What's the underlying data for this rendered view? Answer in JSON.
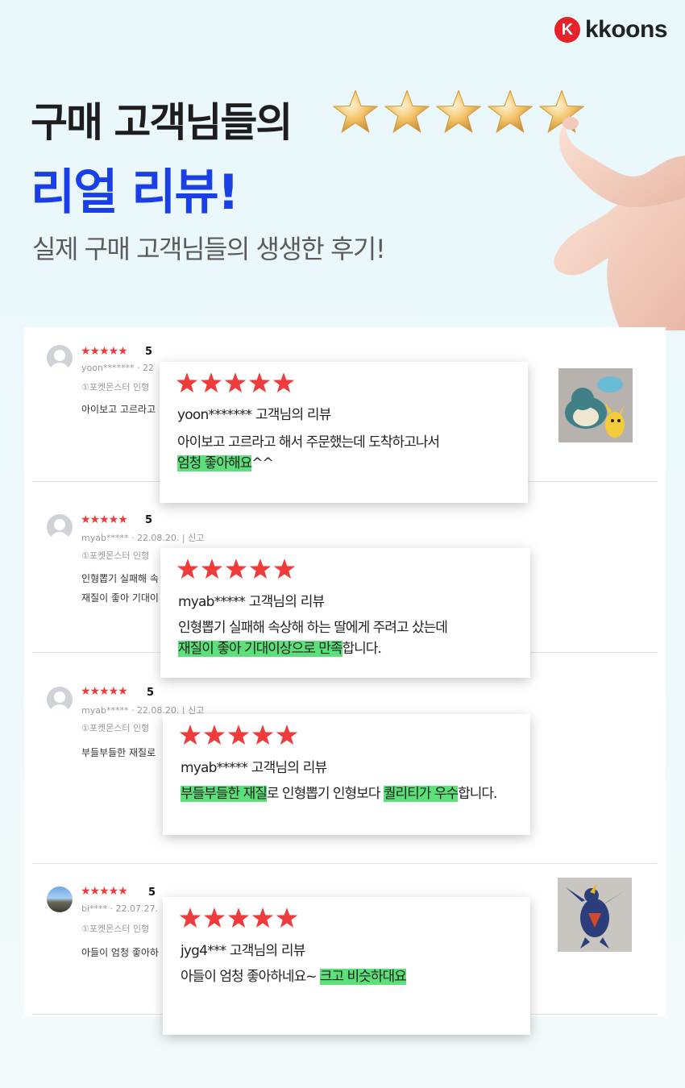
{
  "brand": {
    "mark": "K",
    "name": "kkoons"
  },
  "hero": {
    "line1": "구매 고객님들의",
    "line2": "리얼 리뷰!",
    "subtitle": "실제 구매 고객님들의 생생한 후기!",
    "star_count": 5
  },
  "reviews": [
    {
      "stars": "★★★★★",
      "score": "5",
      "user": "yoon*******",
      "meta": "yoon*******  · 22",
      "option": "①포켓몬스터 인형",
      "body": "아이보고 고르라고",
      "card": {
        "user_line": "yoon*******  고객님의 리뷰",
        "line1": "아이보고 고르라고 해서 주문했는데 도착하고나서",
        "line2_hl": "엄청 좋아해요",
        "line2_rest": "^^"
      },
      "thumb": "plush-toys-photo"
    },
    {
      "stars": "★★★★★",
      "score": "5",
      "meta": "myab*****  · 22.08.20.  |  신고",
      "option": "①포켓몬스터 인형",
      "body1": "인형뽑기 실패해 속",
      "body2": "재질이 좋아 기대이",
      "card": {
        "user_line": "myab*****  고객님의 리뷰",
        "line1": "인형뽑기 실패해 속상해 하는 딸에게 주려고 샀는데",
        "line2_hl": "재질이 좋아 기대이상으로 만족",
        "line2_rest": "합니다."
      }
    },
    {
      "stars": "★★★★★",
      "score": "5",
      "meta": "myab*****  · 22.08.20.  |  신고",
      "option": "①포켓몬스터 인형",
      "body": "부들부들한 재질로",
      "card": {
        "user_line": "myab***** 고객님의 리뷰",
        "hl1": "부들부들한 재질",
        "mid": "로 인형뽑기 인형보다 ",
        "hl2": "퀄리티가 우수",
        "rest": "합니다."
      }
    },
    {
      "stars": "★★★★★",
      "score": "5",
      "meta": "bi****  · 22.07.27.",
      "option": "①포켓몬스터 인형",
      "body": "아들이 엄청 좋아하",
      "card": {
        "user_line": "jyg4***  고객님의 리뷰",
        "line1_plain": "아들이 엄청 좋아하네요~ ",
        "line1_hl": "크고 비슷하대요"
      },
      "thumb": "dragon-plush-photo"
    }
  ],
  "colors": {
    "accent_blue": "#1a3fe6",
    "star_red": "#ef3b3b",
    "highlight": "#5be07a",
    "brand_red": "#e8222b"
  }
}
